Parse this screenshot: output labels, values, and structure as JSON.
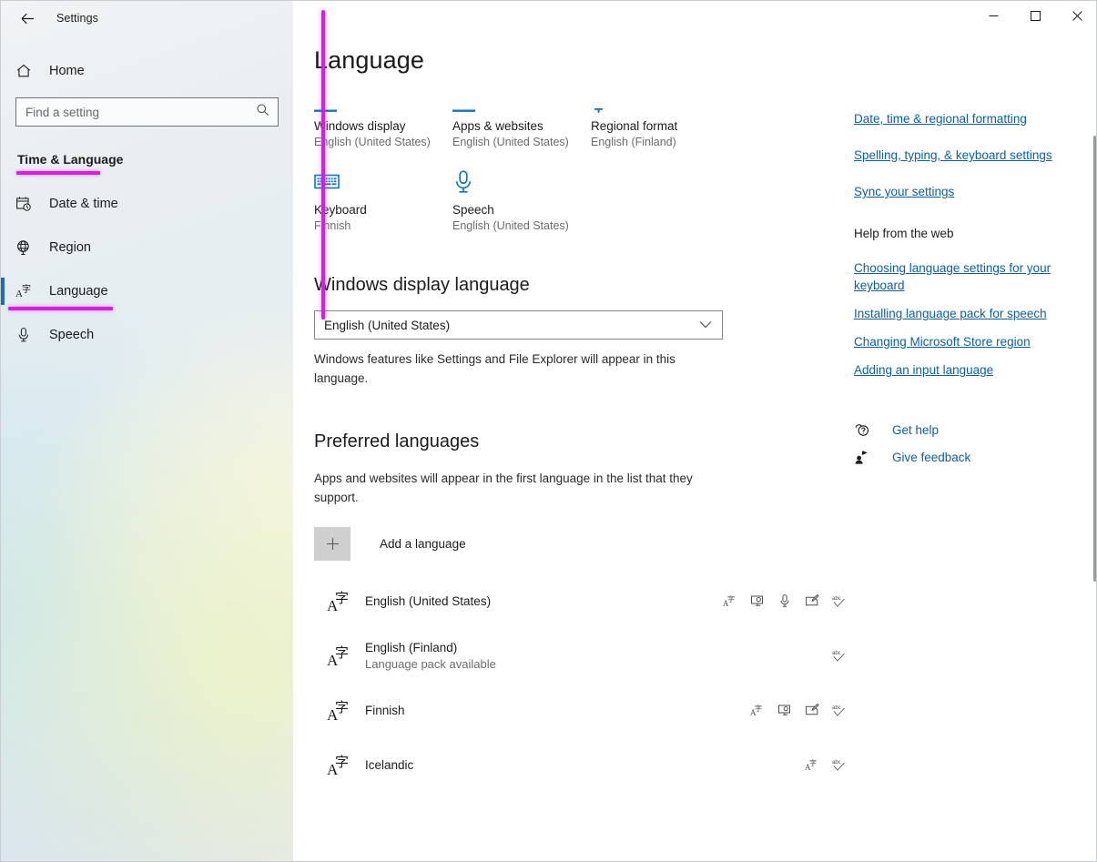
{
  "window": {
    "app_title": "Settings",
    "back_icon": "back-arrow-icon",
    "minimize_label": "—",
    "maximize_label": "□",
    "close_label": "✕"
  },
  "sidebar": {
    "home_label": "Home",
    "home_icon": "home-icon",
    "search": {
      "placeholder": "Find a setting",
      "value": "",
      "icon": "search-icon"
    },
    "group_title": "Time & Language",
    "items": [
      {
        "label": "Date & time",
        "icon": "calendar-clock-icon",
        "selected": false
      },
      {
        "label": "Region",
        "icon": "globe-icon",
        "selected": false
      },
      {
        "label": "Language",
        "icon": "language-icon",
        "selected": true
      },
      {
        "label": "Speech",
        "icon": "microphone-icon",
        "selected": false
      }
    ]
  },
  "main": {
    "page_title": "Language",
    "summary_cards": [
      {
        "name": "Windows display",
        "value": "English (United States)",
        "icon": "display-bar-icon"
      },
      {
        "name": "Apps & websites",
        "value": "English (United States)",
        "icon": "apps-bar-icon"
      },
      {
        "name": "Regional format",
        "value": "English (Finland)",
        "icon": "regional-format-icon"
      },
      {
        "name": "Keyboard",
        "value": "Finnish",
        "icon": "keyboard-icon"
      },
      {
        "name": "Speech",
        "value": "English (United States)",
        "icon": "microphone-icon"
      }
    ],
    "display_language": {
      "heading": "Windows display language",
      "selected": "English (United States)",
      "chevron_icon": "chevron-down-icon",
      "helper": "Windows features like Settings and File Explorer will appear in this language."
    },
    "preferred": {
      "heading": "Preferred languages",
      "description": "Apps and websites will appear in the first language in the list that they support.",
      "add_label": "Add a language",
      "add_icon": "plus-icon",
      "languages": [
        {
          "name": "English (United States)",
          "sub": "",
          "icon": "language-icon",
          "actions": [
            "language-icon",
            "display-icon",
            "microphone-icon",
            "handwriting-icon",
            "spellcheck-icon"
          ]
        },
        {
          "name": "English (Finland)",
          "sub": "Language pack available",
          "icon": "language-icon",
          "actions": [
            "spellcheck-icon"
          ]
        },
        {
          "name": "Finnish",
          "sub": "",
          "icon": "language-icon",
          "actions": [
            "language-icon",
            "display-icon",
            "handwriting-icon",
            "spellcheck-icon"
          ]
        },
        {
          "name": "Icelandic",
          "sub": "",
          "icon": "language-icon",
          "actions": [
            "language-icon",
            "spellcheck-icon"
          ]
        }
      ]
    }
  },
  "rail": {
    "related_links": [
      "Date, time & regional formatting",
      "Spelling, typing, & keyboard settings",
      "Sync your settings"
    ],
    "help_heading": "Help from the web",
    "help_links": [
      "Choosing language settings for your keyboard",
      "Installing language pack for speech",
      "Changing Microsoft Store region",
      "Adding an input language"
    ],
    "support": [
      {
        "label": "Get help",
        "icon": "help-bubble-icon"
      },
      {
        "label": "Give feedback",
        "icon": "feedback-icon"
      }
    ]
  },
  "annotations": {
    "highlight_color": "#d61fe0",
    "accent_color": "#0078d4",
    "link_color": "#0b5fa4"
  }
}
